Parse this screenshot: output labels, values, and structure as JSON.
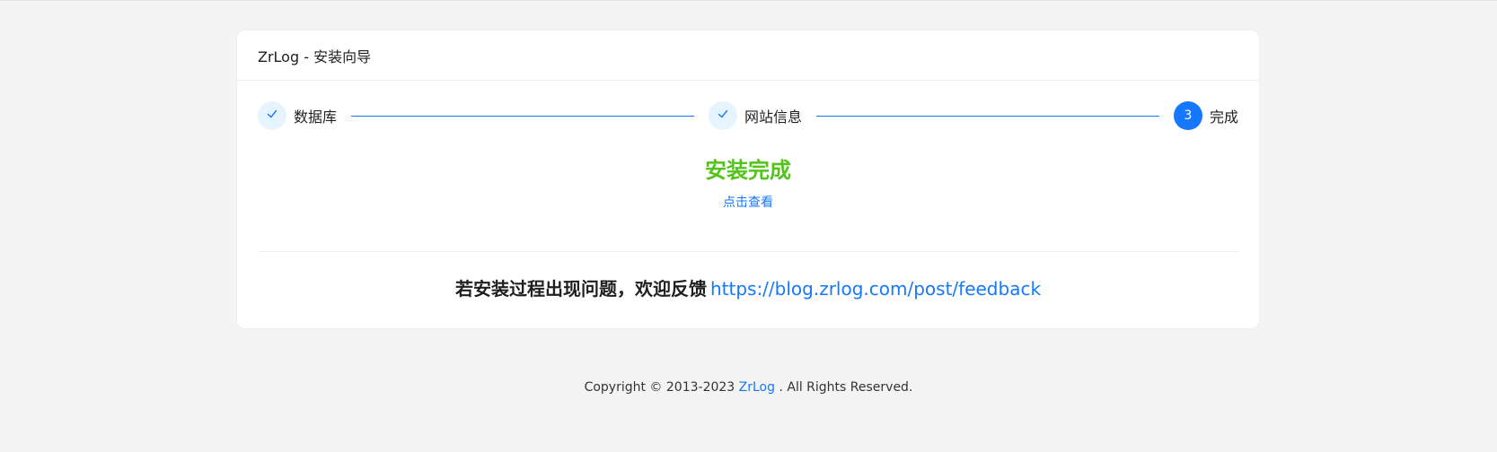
{
  "header": {
    "title": "ZrLog - 安装向导"
  },
  "steps": [
    {
      "label": "数据库",
      "status": "done",
      "icon": "check-icon"
    },
    {
      "label": "网站信息",
      "status": "done",
      "icon": "check-icon"
    },
    {
      "label": "完成",
      "status": "current",
      "number": "3"
    }
  ],
  "result": {
    "title": "安装完成",
    "view_link": "点击查看"
  },
  "feedback": {
    "text": "若安装过程出现问题，欢迎反馈",
    "link": "https://blog.zrlog.com/post/feedback"
  },
  "footer": {
    "prefix": "Copyright © 2013-2023",
    "brand": "ZrLog",
    "suffix": ". All Rights Reserved."
  },
  "colors": {
    "primary": "#1677ff",
    "success": "#52c41a",
    "step_done_bg": "#e6f4ff",
    "page_bg": "#f4f4f4"
  }
}
